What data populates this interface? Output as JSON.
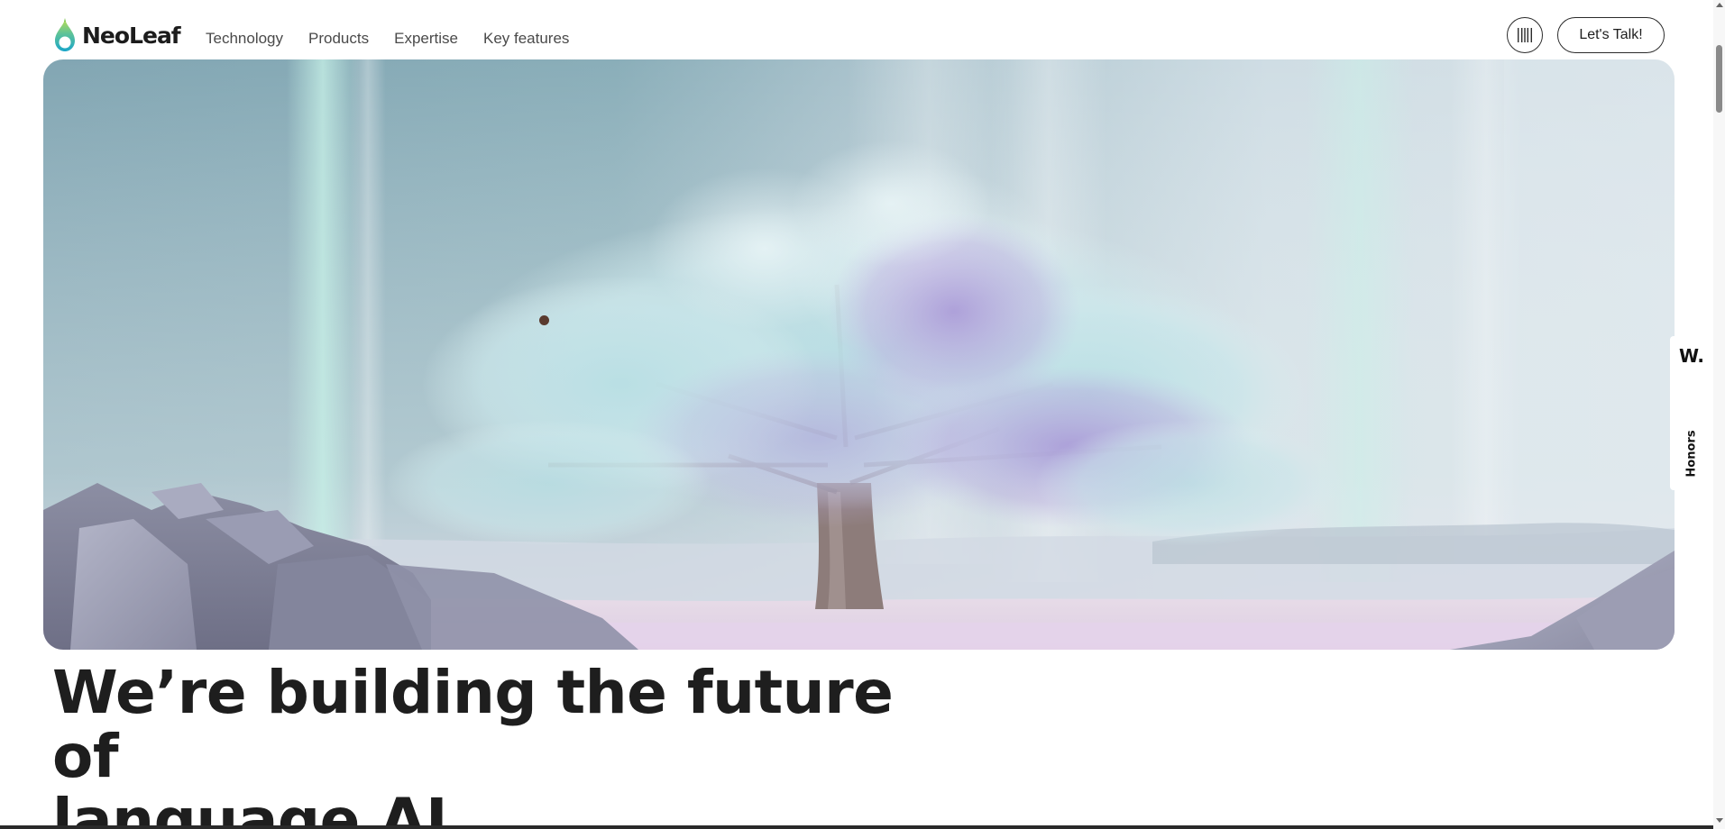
{
  "header": {
    "brand": "NeoLeaf",
    "nav": [
      {
        "label": "Technology"
      },
      {
        "label": "Products"
      },
      {
        "label": "Expertise"
      },
      {
        "label": "Key features"
      }
    ],
    "menu_icon": "barcode-lines-icon",
    "cta_label": "Let's Talk!"
  },
  "hero": {
    "image": "surreal frosted tree with lavender and teal foliage among rocks"
  },
  "side_widget": {
    "logo": "W.",
    "label": "Honors"
  },
  "main": {
    "headline_line1": "We’re building the future of",
    "headline_line2": "language AI"
  },
  "colors": {
    "text": "#1e1e1e",
    "nav_text": "#4a4a4a",
    "logo_green": "#8cc63f",
    "logo_teal": "#1aa6c9",
    "background": "#ffffff"
  }
}
